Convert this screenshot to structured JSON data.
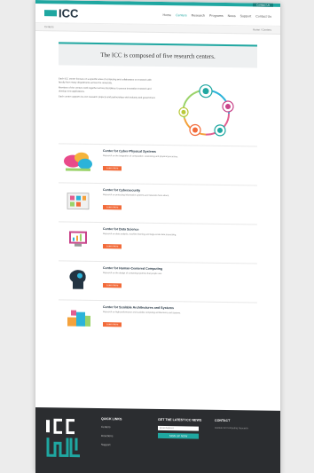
{
  "header": {
    "contact_button": "Contact Us",
    "logo": "ICC",
    "nav": [
      "Home",
      "Centers",
      "Research",
      "Programs",
      "News",
      "Support",
      "Contact Us"
    ]
  },
  "breadcrumb": {
    "left": "Centers",
    "right": "Home / Centers"
  },
  "headline": "The ICC is composed of five research centers.",
  "intro": {
    "paragraphs": [
      "Each ICC center focuses on a specific area of computing and collaborates on research with faculty from many departments across the university.",
      "Members of the centers work together across disciplines to pursue innovative research and develop new applications.",
      "Each center supports its own research projects and partnerships with industry and government."
    ]
  },
  "centers": [
    {
      "title": "Center for Cyber-Physical Systems",
      "desc": "Research on the integration of computation, networking and physical processes.",
      "button": "Learn More"
    },
    {
      "title": "Center for Cybersecurity",
      "desc": "Research on protecting information systems and networks from attack.",
      "button": "Learn More"
    },
    {
      "title": "Center for Data Science",
      "desc": "Research on data analysis, machine learning and large-scale data processing.",
      "button": "Learn More"
    },
    {
      "title": "Center for Human-Centered Computing",
      "desc": "Research on the design of computing systems that people use.",
      "button": "Learn More"
    },
    {
      "title": "Center for Scalable Architectures and Systems",
      "desc": "Research on high-performance and scalable computing architectures and systems.",
      "button": "Learn More"
    }
  ],
  "footer": {
    "quick_links_title": "QUICK LINKS",
    "links": [
      "Centers",
      "Directions",
      "Support"
    ],
    "news_title": "GET THE LATEST ICC NEWS",
    "email_placeholder": "Email Address",
    "signup_label": "SIGN UP NOW",
    "contact_title": "CONTACT",
    "contact_text": "Institute for Computing Research"
  },
  "colors": {
    "accent": "#1fa7a1",
    "button": "#f26b3a",
    "footer": "#2b2d30"
  }
}
